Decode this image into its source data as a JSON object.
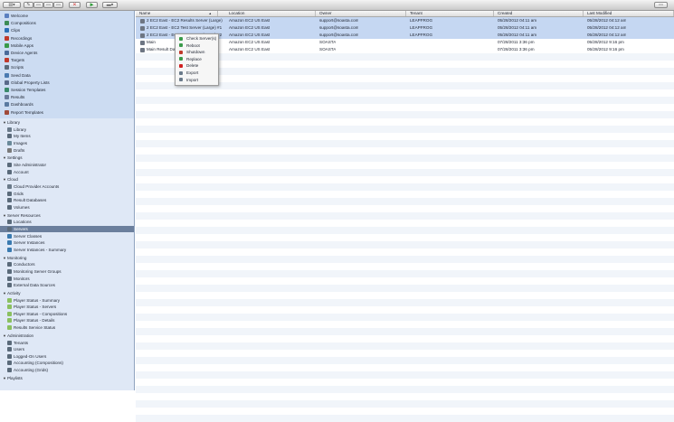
{
  "colors": {
    "sidebar_bg": "#dfe8f6",
    "sidebar_top_bg": "#ccdcf2",
    "selection_row": "#c5d7f2",
    "selected_nav": "#6b7f9d"
  },
  "toolbar": {
    "buttons": [
      {
        "name": "workspace-menu-button",
        "glyph": "▤▾"
      },
      {
        "name": "edit-button",
        "glyph": "✎"
      },
      {
        "name": "copy-button",
        "glyph": "▭"
      },
      {
        "name": "duplicate-button",
        "glyph": "▭"
      },
      {
        "name": "folder-button",
        "glyph": "▭"
      },
      {
        "name": "delete-button",
        "glyph": "✕"
      },
      {
        "name": "play-button",
        "glyph": "▶"
      },
      {
        "name": "view-options-button",
        "glyph": "▬▾"
      },
      {
        "name": "window-button",
        "glyph": "▭"
      }
    ]
  },
  "sidebar": {
    "top_items": [
      {
        "label": "Welcome",
        "icon": "welcome-icon",
        "color": "#5a7fc0"
      },
      {
        "label": "Compositions",
        "icon": "compositions-icon",
        "color": "#3d8c55"
      },
      {
        "label": "Clips",
        "icon": "clips-icon",
        "color": "#2c6fb5"
      },
      {
        "label": "Recordings",
        "icon": "recordings-icon",
        "color": "#c0392b"
      },
      {
        "label": "Mobile Apps",
        "icon": "mobile-apps-icon",
        "color": "#3a9a4a"
      },
      {
        "label": "Device Agents",
        "icon": "device-agents-icon",
        "color": "#4a6a9a"
      },
      {
        "label": "Targets",
        "icon": "targets-icon",
        "color": "#c0392b"
      },
      {
        "label": "Scripts",
        "icon": "scripts-icon",
        "color": "#5a6a7a"
      },
      {
        "label": "Seed Data",
        "icon": "seed-data-icon",
        "color": "#4a7ab0"
      },
      {
        "label": "Global Property Lists",
        "icon": "property-lists-icon",
        "color": "#5a6a8a"
      },
      {
        "label": "Session Templates",
        "icon": "session-templates-icon",
        "color": "#3a8a6a"
      },
      {
        "label": "Results",
        "icon": "results-icon",
        "color": "#6a7a9a"
      },
      {
        "label": "Dashboards",
        "icon": "dashboards-icon",
        "color": "#5a7aa0"
      },
      {
        "label": "Report Templates",
        "icon": "report-templates-icon",
        "color": "#a04a3a"
      }
    ],
    "sections": [
      {
        "title": "Library",
        "items": [
          {
            "label": "Library",
            "icon": "library-icon",
            "color": "#6a7a8a"
          },
          {
            "label": "My Items",
            "icon": "my-items-icon",
            "color": "#5a6a7a"
          },
          {
            "label": "Images",
            "icon": "images-icon",
            "color": "#6a8a9a"
          },
          {
            "label": "Drafts",
            "icon": "drafts-icon",
            "color": "#7a7a7a"
          }
        ]
      },
      {
        "title": "Settings",
        "items": [
          {
            "label": "Site Administrator",
            "icon": "site-admin-icon",
            "color": "#5a6a7a"
          },
          {
            "label": "Account",
            "icon": "account-icon",
            "color": "#5a6a7a"
          }
        ]
      },
      {
        "title": "Cloud",
        "items": [
          {
            "label": "Cloud Provider Accounts",
            "icon": "cloud-accounts-icon",
            "color": "#6a7a8a"
          },
          {
            "label": "Grids",
            "icon": "grids-icon",
            "color": "#5a6a7a"
          },
          {
            "label": "Result Databases",
            "icon": "result-databases-icon",
            "color": "#5a6a7a"
          },
          {
            "label": "Volumes",
            "icon": "volumes-icon",
            "color": "#5a6a7a"
          }
        ]
      },
      {
        "title": "Server Resources",
        "items": [
          {
            "label": "Locations",
            "icon": "locations-icon",
            "color": "#5a6a7a"
          },
          {
            "label": "Servers",
            "icon": "servers-icon",
            "color": "#5a6a7a",
            "selected": true
          },
          {
            "label": "Server Classes",
            "icon": "server-classes-icon",
            "color": "#3a7ab0"
          },
          {
            "label": "Server Instances",
            "icon": "server-instances-icon",
            "color": "#3a7ab0"
          },
          {
            "label": "Server Instances - Summary",
            "icon": "server-instances-summary-icon",
            "color": "#3a7ab0"
          }
        ]
      },
      {
        "title": "Monitoring",
        "items": [
          {
            "label": "Conductors",
            "icon": "conductors-icon",
            "color": "#5a6a7a"
          },
          {
            "label": "Monitoring Server Groups",
            "icon": "monitoring-groups-icon",
            "color": "#5a6a7a"
          },
          {
            "label": "Monitors",
            "icon": "monitors-icon",
            "color": "#5a6a7a"
          },
          {
            "label": "External Data Sources",
            "icon": "external-data-icon",
            "color": "#5a6a7a"
          }
        ]
      },
      {
        "title": "Activity",
        "items": [
          {
            "label": "Player Status - Summary",
            "icon": "status-summary-icon",
            "color": "#8ac060"
          },
          {
            "label": "Player Status - Servers",
            "icon": "status-servers-icon",
            "color": "#8ac060"
          },
          {
            "label": "Player Status - Compositions",
            "icon": "status-compositions-icon",
            "color": "#8ac060"
          },
          {
            "label": "Player Status - Details",
            "icon": "status-details-icon",
            "color": "#8ac060"
          },
          {
            "label": "Results Service Status",
            "icon": "results-service-icon",
            "color": "#8ac060"
          }
        ]
      },
      {
        "title": "Administration",
        "items": [
          {
            "label": "Tenants",
            "icon": "tenants-icon",
            "color": "#5a6a7a"
          },
          {
            "label": "Users",
            "icon": "users-icon",
            "color": "#5a6a7a"
          },
          {
            "label": "Logged-On Users",
            "icon": "logged-on-users-icon",
            "color": "#5a6a7a"
          },
          {
            "label": "Accounting (Compositions)",
            "icon": "accounting-compositions-icon",
            "color": "#5a6a7a"
          },
          {
            "label": "Accounting (Grids)",
            "icon": "accounting-grids-icon",
            "color": "#5a6a7a"
          }
        ]
      },
      {
        "title": "Playlists",
        "items": []
      }
    ]
  },
  "table": {
    "columns": [
      "Name",
      "Location",
      "Owner",
      "Tenant",
      "Created",
      "Last Modified"
    ],
    "rows": [
      {
        "cells": [
          "2 EC2 East - EC2 Results Server (Large)",
          "Amazon EC2 US East",
          "support@soasta.com",
          "LEAPFROG",
          "05/28/2012 04:11 am",
          "05/28/2012 04:12 am"
        ],
        "selected": true
      },
      {
        "cells": [
          "2 EC2 East - EC2 Test Server (Large) #1",
          "Amazon EC2 US East",
          "support@soasta.com",
          "LEAPFROG",
          "05/28/2012 04:11 am",
          "05/28/2012 04:12 am"
        ],
        "selected": true
      },
      {
        "cells": [
          "2 EC2 East - EC2 Test Server (Large) #2",
          "Amazon EC2 US East",
          "support@soasta.com",
          "LEAPFROG",
          "05/28/2012 04:11 am",
          "05/28/2012 04:12 am"
        ],
        "selected": true
      },
      {
        "cells": [
          "Main",
          "Amazon EC2 US East",
          "SOASTA",
          "",
          "07/28/2011 3:36 pm",
          "05/28/2012 9:16 pm"
        ],
        "selected": false
      },
      {
        "cells": [
          "Main Result Database",
          "Amazon EC2 US East",
          "SOASTA",
          "",
          "07/28/2011 3:36 pm",
          "05/28/2012 9:16 pm"
        ],
        "selected": false
      }
    ]
  },
  "context_menu": {
    "items": [
      {
        "label": "Check Server(s)",
        "icon": "check-server-icon",
        "color": "#3a9a4a"
      },
      {
        "label": "Reboot",
        "icon": "reboot-icon",
        "color": "#3a9a4a"
      },
      {
        "label": "Shutdown",
        "icon": "shutdown-icon",
        "color": "#c0392b"
      },
      {
        "label": "Replace",
        "icon": "replace-icon",
        "color": "#3a9a4a"
      },
      {
        "label": "Delete",
        "icon": "delete-icon",
        "color": "#d01f1f"
      },
      {
        "label": "Export",
        "icon": "export-icon",
        "color": "#6a7a8a"
      },
      {
        "label": "Import",
        "icon": "import-icon",
        "color": "#6a7a8a"
      }
    ]
  }
}
